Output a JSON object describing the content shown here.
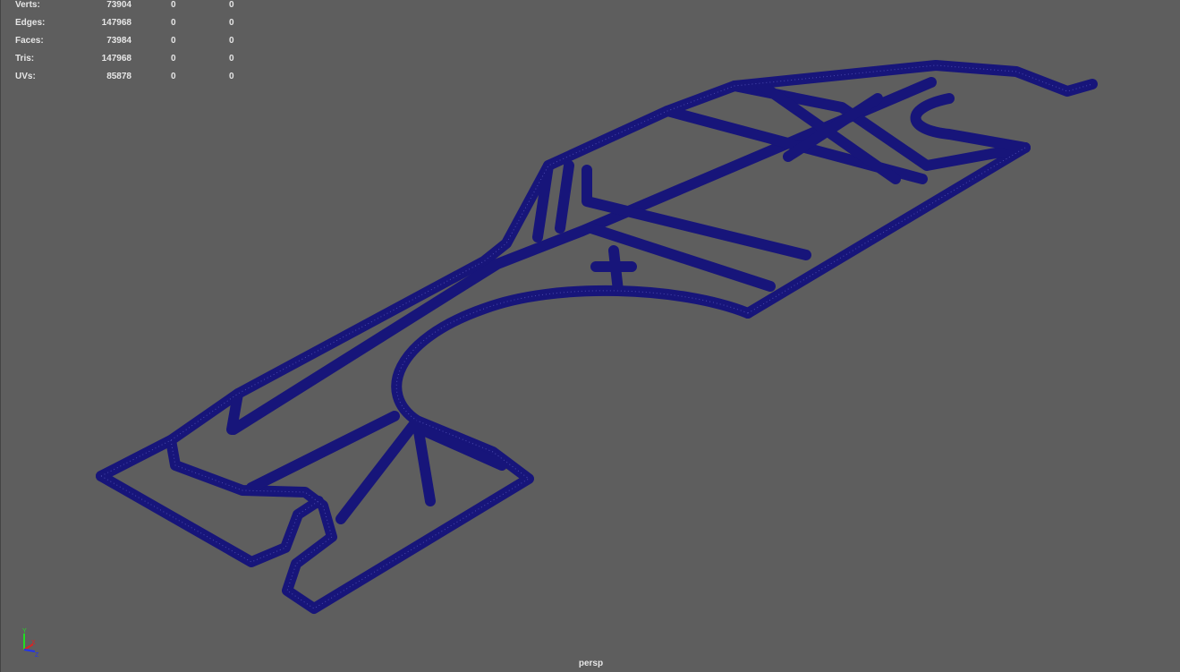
{
  "hud": {
    "rows": [
      {
        "label": "Verts:",
        "v1": "73904",
        "v2": "0",
        "v3": "0"
      },
      {
        "label": "Edges:",
        "v1": "147968",
        "v2": "0",
        "v3": "0"
      },
      {
        "label": "Faces:",
        "v1": "73984",
        "v2": "0",
        "v3": "0"
      },
      {
        "label": "Tris:",
        "v1": "147968",
        "v2": "0",
        "v3": "0"
      },
      {
        "label": "UVs:",
        "v1": "85878",
        "v2": "0",
        "v3": "0"
      }
    ]
  },
  "camera_label": "persp",
  "colors": {
    "background": "#5e5e5e",
    "wireframe": "#17157a",
    "mesh_lines": "#6b6bd0"
  },
  "axis": {
    "x": "X",
    "y": "Y",
    "z": "Z"
  }
}
